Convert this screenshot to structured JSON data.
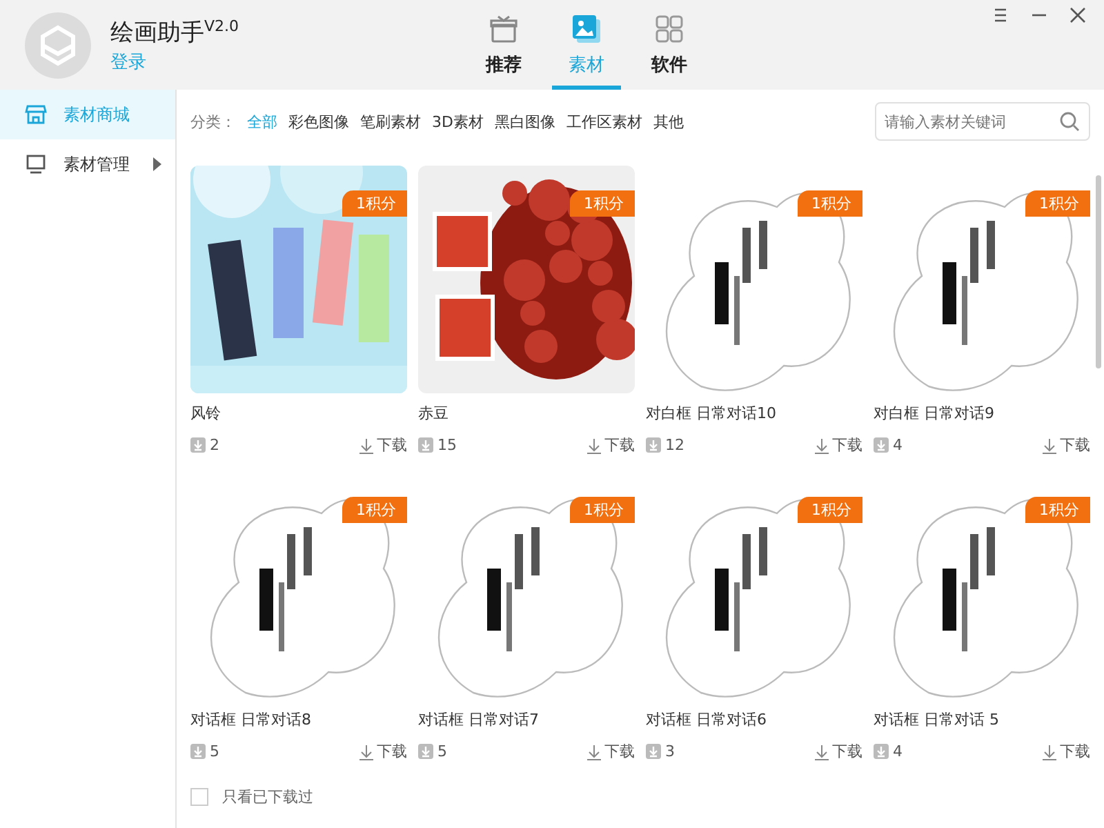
{
  "app": {
    "title": "绘画助手$^{V2.0}$",
    "login": "登录"
  },
  "tabs": [
    {
      "label": "推荐",
      "selected": false
    },
    {
      "label": "素材",
      "selected": true
    },
    {
      "label": "软件",
      "selected": false
    }
  ],
  "sidebar": {
    "items": [
      {
        "label": "素材商城",
        "selected": true
      },
      {
        "label": "素材管理",
        "selected": false,
        "expanded": false
      }
    ]
  },
  "filter": {
    "label": "分类：",
    "options": [
      {
        "label": "全部",
        "selected": true
      },
      {
        "label": "彩色图像",
        "selected": false
      },
      {
        "label": "笔刷素材",
        "selected": false
      },
      {
        "label": "3D素材",
        "selected": false
      },
      {
        "label": "黑白图像",
        "selected": false
      },
      {
        "label": "工作区素材",
        "selected": false
      },
      {
        "label": "其他",
        "selected": false
      }
    ]
  },
  "search": {
    "placeholder": "请输入素材关键词"
  },
  "materials": [
    {
      "title": "风铃",
      "badge": "1积分",
      "count": "2",
      "download": "下载"
    },
    {
      "title": "赤豆",
      "badge": "1积分",
      "count": "15",
      "download": "下载"
    },
    {
      "title": "对白框 日常对话10",
      "badge": "1积分",
      "count": "12",
      "download": "下载"
    },
    {
      "title": "对白框 日常对话9",
      "badge": "1积分",
      "count": "4",
      "download": "下载"
    },
    {
      "title": "对话框 日常对话8",
      "badge": "1积分",
      "count": "5",
      "download": "下载"
    },
    {
      "title": "对话框 日常对话7",
      "badge": "1积分",
      "count": "5",
      "download": "下载"
    },
    {
      "title": "对话框 日常对话6",
      "badge": "1积分",
      "count": "3",
      "download": "下载"
    },
    {
      "title": "对话框 日常对话 5",
      "badge": "1积分",
      "count": "4",
      "download": "下载"
    }
  ],
  "downloaded_only": {
    "label": "只看已下载过",
    "checked": false
  }
}
